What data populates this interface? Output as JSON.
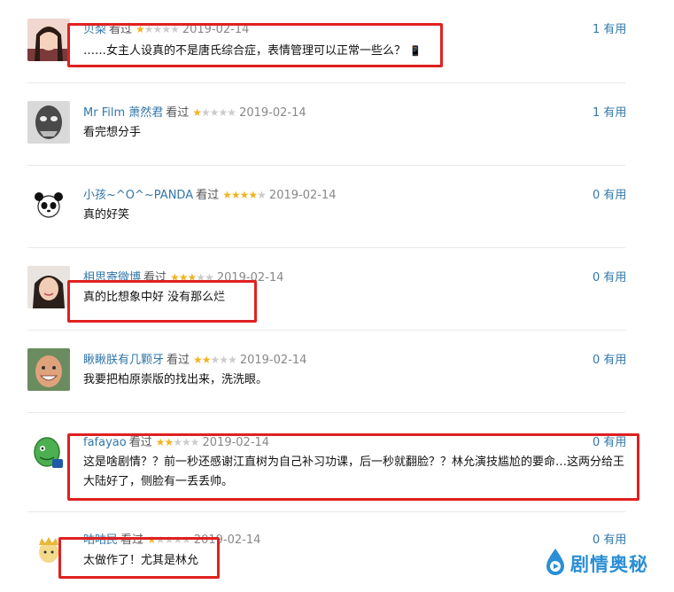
{
  "comments": [
    {
      "user": "贝梨",
      "action": "看过",
      "rating": 1,
      "date": "2019-02-14",
      "votes": "1 有用",
      "text": "……女主人设真的不是唐氏综合症，表情管理可以正常一些么？",
      "emoji": "📱"
    },
    {
      "user": "Mr Film 萧然君",
      "action": "看过",
      "rating": 1,
      "date": "2019-02-14",
      "votes": "1 有用",
      "text": "看完想分手"
    },
    {
      "user": "小孩~^O^~PANDA",
      "action": "看过",
      "rating": 4,
      "date": "2019-02-14",
      "votes": "0 有用",
      "text": "真的好笑"
    },
    {
      "user": "相思寄微博",
      "action": "看过",
      "rating": 3,
      "date": "2019-02-14",
      "votes": "0 有用",
      "text": "真的比想象中好 没有那么烂"
    },
    {
      "user": "瞅瞅朕有几颗牙",
      "action": "看过",
      "rating": 2,
      "date": "2019-02-14",
      "votes": "0 有用",
      "text": "我要把柏原崇版的找出来，洗洗眼。"
    },
    {
      "user": "fafayao",
      "action": "看过",
      "rating": 2,
      "date": "2019-02-14",
      "votes": "0 有用",
      "text_line1": "这是啥剧情？？前一秒还感谢江直树为自己补习功课，后一秒就翻脸？？林允演技尴尬的要命…这两分给王",
      "text_line2": "大陆好了，侧脸有一丢丢帅。"
    },
    {
      "user": "咕咕民",
      "action": "看过",
      "rating": 1,
      "date": "2019-02-14",
      "votes": "0 有用",
      "text": "太做作了！尤其是林允"
    }
  ],
  "watermark": {
    "text": "剧情奥秘"
  },
  "colors": {
    "link": "#3377aa",
    "star_on": "#f4b324",
    "star_off": "#cccccc",
    "highlight": "#e02020",
    "watermark": "#2a8fd6"
  }
}
